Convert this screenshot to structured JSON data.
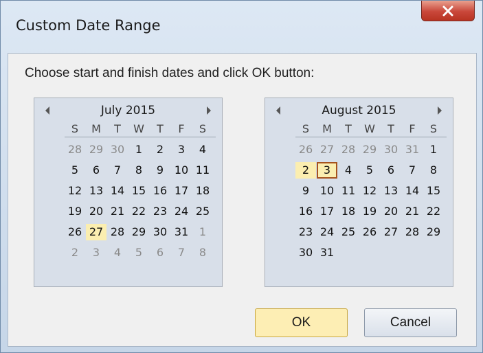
{
  "dialog": {
    "title": "Custom Date Range",
    "prompt": "Choose start and finish dates and click OK button:",
    "ok_label": "OK",
    "cancel_label": "Cancel",
    "close_icon": "close-icon"
  },
  "weekdays": [
    "S",
    "M",
    "T",
    "W",
    "T",
    "F",
    "S"
  ],
  "calendars": [
    {
      "month": "July 2015",
      "weeks": [
        [
          {
            "d": "28",
            "o": true
          },
          {
            "d": "29",
            "o": true
          },
          {
            "d": "30",
            "o": true
          },
          {
            "d": "1"
          },
          {
            "d": "2"
          },
          {
            "d": "3"
          },
          {
            "d": "4"
          }
        ],
        [
          {
            "d": "5"
          },
          {
            "d": "6"
          },
          {
            "d": "7"
          },
          {
            "d": "8"
          },
          {
            "d": "9"
          },
          {
            "d": "10"
          },
          {
            "d": "11"
          }
        ],
        [
          {
            "d": "12"
          },
          {
            "d": "13"
          },
          {
            "d": "14"
          },
          {
            "d": "15"
          },
          {
            "d": "16"
          },
          {
            "d": "17"
          },
          {
            "d": "18"
          }
        ],
        [
          {
            "d": "19"
          },
          {
            "d": "20"
          },
          {
            "d": "21"
          },
          {
            "d": "22"
          },
          {
            "d": "23"
          },
          {
            "d": "24"
          },
          {
            "d": "25"
          }
        ],
        [
          {
            "d": "26"
          },
          {
            "d": "27",
            "h": true
          },
          {
            "d": "28"
          },
          {
            "d": "29"
          },
          {
            "d": "30"
          },
          {
            "d": "31"
          },
          {
            "d": "1",
            "o": true
          }
        ],
        [
          {
            "d": "2",
            "o": true
          },
          {
            "d": "3",
            "o": true
          },
          {
            "d": "4",
            "o": true
          },
          {
            "d": "5",
            "o": true
          },
          {
            "d": "6",
            "o": true
          },
          {
            "d": "7",
            "o": true
          },
          {
            "d": "8",
            "o": true
          }
        ]
      ]
    },
    {
      "month": "August 2015",
      "weeks": [
        [
          {
            "d": "26",
            "o": true
          },
          {
            "d": "27",
            "o": true
          },
          {
            "d": "28",
            "o": true
          },
          {
            "d": "29",
            "o": true
          },
          {
            "d": "30",
            "o": true
          },
          {
            "d": "31",
            "o": true
          },
          {
            "d": "1"
          }
        ],
        [
          {
            "d": "2",
            "h": true
          },
          {
            "d": "3",
            "t": true
          },
          {
            "d": "4"
          },
          {
            "d": "5"
          },
          {
            "d": "6"
          },
          {
            "d": "7"
          },
          {
            "d": "8"
          }
        ],
        [
          {
            "d": "9"
          },
          {
            "d": "10"
          },
          {
            "d": "11"
          },
          {
            "d": "12"
          },
          {
            "d": "13"
          },
          {
            "d": "14"
          },
          {
            "d": "15"
          }
        ],
        [
          {
            "d": "16"
          },
          {
            "d": "17"
          },
          {
            "d": "18"
          },
          {
            "d": "19"
          },
          {
            "d": "20"
          },
          {
            "d": "21"
          },
          {
            "d": "22"
          }
        ],
        [
          {
            "d": "23"
          },
          {
            "d": "24"
          },
          {
            "d": "25"
          },
          {
            "d": "26"
          },
          {
            "d": "27"
          },
          {
            "d": "28"
          },
          {
            "d": "29"
          }
        ],
        [
          {
            "d": "30"
          },
          {
            "d": "31"
          }
        ]
      ]
    }
  ]
}
